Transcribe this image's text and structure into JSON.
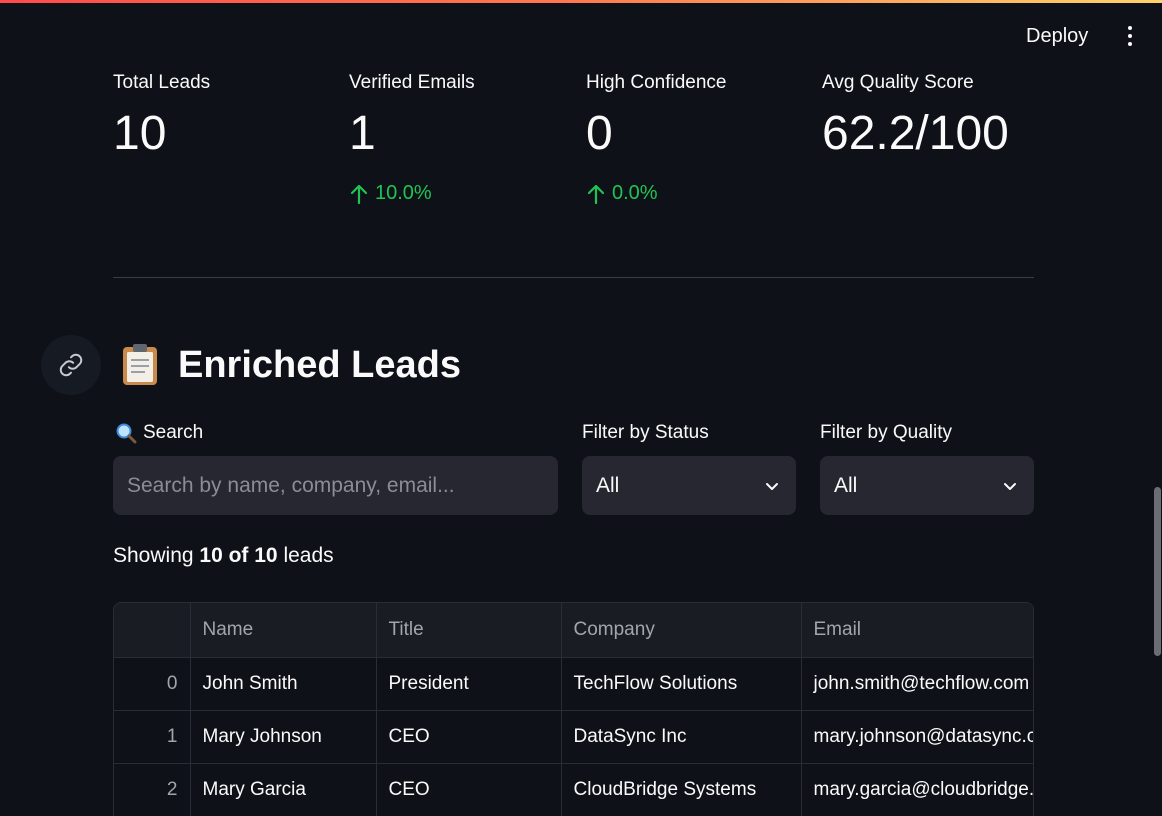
{
  "header": {
    "deploy_label": "Deploy",
    "menu_icon": "more-vertical-icon",
    "accent_gradient": [
      "#ff4b4b",
      "#ffd36b"
    ]
  },
  "metrics": [
    {
      "label": "Total Leads",
      "value": "10",
      "delta": ""
    },
    {
      "label": "Verified Emails",
      "value": "1",
      "delta": "10.0%"
    },
    {
      "label": "High Confidence",
      "value": "0",
      "delta": "0.0%"
    },
    {
      "label": "Avg Quality Score",
      "value": "62.2/100",
      "delta": ""
    }
  ],
  "delta_color": "#21c354",
  "section": {
    "emoji": "clipboard-icon",
    "title": "Enriched Leads",
    "anchor_icon": "link-icon"
  },
  "filters": {
    "search_label": "Search",
    "search_icon": "magnifier-icon",
    "search_placeholder": "Search by name, company, email...",
    "status_label": "Filter by Status",
    "status_value": "All",
    "quality_label": "Filter by Quality",
    "quality_value": "All"
  },
  "showing": {
    "prefix": "Showing ",
    "shown": "10",
    "of": " of ",
    "total": "10",
    "suffix": " leads"
  },
  "table": {
    "columns": [
      "",
      "Name",
      "Title",
      "Company",
      "Email"
    ],
    "rows": [
      [
        "0",
        "John Smith",
        "President",
        "TechFlow Solutions",
        "john.smith@techflow.com"
      ],
      [
        "1",
        "Mary Johnson",
        "CEO",
        "DataSync Inc",
        "mary.johnson@datasync.com"
      ],
      [
        "2",
        "Mary Garcia",
        "CEO",
        "CloudBridge Systems",
        "mary.garcia@cloudbridge.com"
      ]
    ]
  }
}
